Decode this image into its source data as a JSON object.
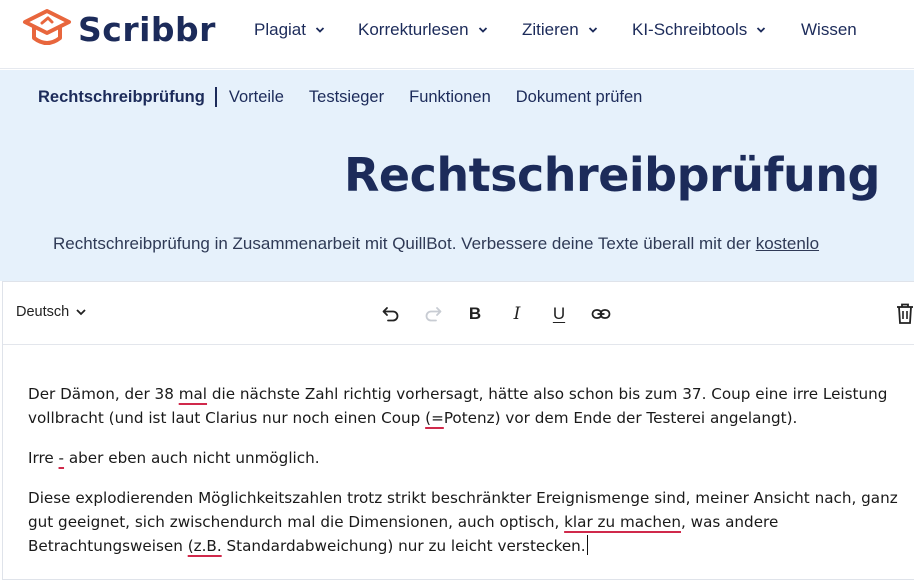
{
  "brand": {
    "name": "Scribbr",
    "color": "#1c2b5a",
    "accent": "#e8663d"
  },
  "nav": {
    "items": [
      {
        "label": "Plagiat",
        "has_dropdown": true
      },
      {
        "label": "Korrekturlesen",
        "has_dropdown": true
      },
      {
        "label": "Zitieren",
        "has_dropdown": true
      },
      {
        "label": "KI-Schreibtools",
        "has_dropdown": true
      },
      {
        "label": "Wissen",
        "has_dropdown": false
      }
    ]
  },
  "subnav": {
    "active": "Rechtschreibprüfung",
    "links": [
      "Vorteile",
      "Testsieger",
      "Funktionen",
      "Dokument prüfen"
    ]
  },
  "hero": {
    "title": "Rechtschreibprüfung",
    "subtitle_pre": "Rechtschreibprüfung in Zusammenarbeit mit QuillBot. Verbessere deine Texte überall mit der ",
    "subtitle_link": "kostenlo"
  },
  "editor": {
    "language": "Deutsch",
    "toolbar": [
      "undo-icon",
      "redo-icon",
      "bold-icon",
      "italic-icon",
      "underline-icon",
      "link-icon",
      "trash-icon"
    ],
    "toolbar_text": {
      "bold": "B",
      "italic": "I",
      "underline": "U"
    },
    "error_color": "#d0294b",
    "paragraphs": {
      "p1": {
        "a": "Der Dämon, der 38 ",
        "e1": "mal",
        "b": " die nächste Zahl richtig vorhersagt, hätte also schon bis zum 37. Coup eine irre Leistung vollbracht (und ist laut Clarius nur noch einen Coup ",
        "e2": "(=",
        "c": "Potenz) vor dem Ende der Testerei angelangt)."
      },
      "p2": {
        "a": "Irre ",
        "e1": "-",
        "b": " aber eben auch nicht unmöglich."
      },
      "p3": {
        "a": "Diese explodierenden Möglichkeitszahlen trotz strikt beschränkter Ereignismenge sind, meiner Ansicht nach, ganz gut geeignet, sich zwischendurch mal die Dimensionen, auch optisch, ",
        "e1": "klar zu machen",
        "b": ", was andere Betrachtungsweisen ",
        "e2": "(z.B.",
        "c": " Standardabweichung) nur zu leicht verstecken."
      }
    }
  }
}
